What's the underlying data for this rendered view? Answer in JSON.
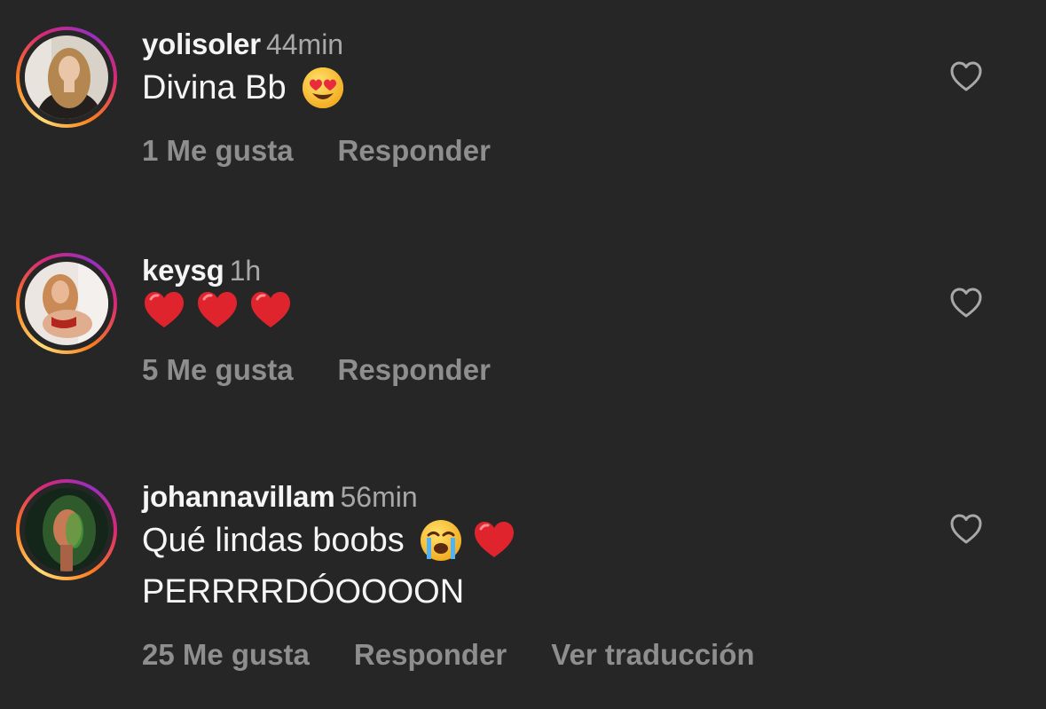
{
  "comments": [
    {
      "username": "yolisoler",
      "time": "44min",
      "text": "Divina Bb",
      "emojis": [
        "heart-eyes-emoji"
      ],
      "likes_label": "1 Me gusta",
      "reply_label": "Responder",
      "avatar_colors": [
        "#d8cdbf",
        "#b68a52",
        "#2a2623"
      ]
    },
    {
      "username": "keysg",
      "time": "1h",
      "text": "",
      "emojis": [
        "red-heart-emoji",
        "red-heart-emoji",
        "red-heart-emoji"
      ],
      "likes_label": "5 Me gusta",
      "reply_label": "Responder",
      "avatar_colors": [
        "#e7e2de",
        "#c98a55",
        "#b3261e"
      ]
    },
    {
      "username": "johannavillam",
      "time": "56min",
      "text": "Qué lindas boobs",
      "text_line2": "PERRRRDÓOOOON",
      "emojis": [
        "loudly-crying-emoji",
        "red-heart-emoji"
      ],
      "likes_label": "25 Me gusta",
      "reply_label": "Responder",
      "translate_label": "Ver traducción",
      "avatar_colors": [
        "#1b3a1f",
        "#3f8f3a",
        "#c77a55"
      ]
    }
  ],
  "colors": {
    "background": "#262626",
    "primary_text": "#f5f5f5",
    "secondary_text": "#a8a8a8",
    "action_text": "#8e8e8e",
    "heart": "#e0242e"
  }
}
